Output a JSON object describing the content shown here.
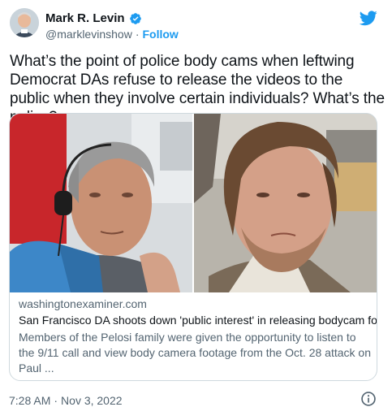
{
  "author": {
    "name": "Mark R. Levin",
    "handle": "@marklevinshow",
    "separator": "·",
    "follow_label": "Follow"
  },
  "tweet": {
    "text": "What’s the point of police body cams when leftwing Democrat DAs refuse to release the videos to the public when they involve certain individuals?  What’s the policy?"
  },
  "card": {
    "domain": "washingtonexaminer.com",
    "headline": "San Francisco DA shoots down 'public interest' in releasing bodycam foo...",
    "description": "Members of the Pelosi family were given the opportunity to listen to the 9/11 call and view body camera footage from the Oct. 28 attack on Paul ..."
  },
  "footer": {
    "time": "7:28 AM",
    "separator": "·",
    "date": "Nov 3, 2022"
  },
  "colors": {
    "accent": "#1d9bf0",
    "text": "#0f1419",
    "secondary": "#536471",
    "border": "#cfd9de"
  },
  "icons": [
    "verified-badge-icon",
    "twitter-bird-icon",
    "info-icon"
  ]
}
